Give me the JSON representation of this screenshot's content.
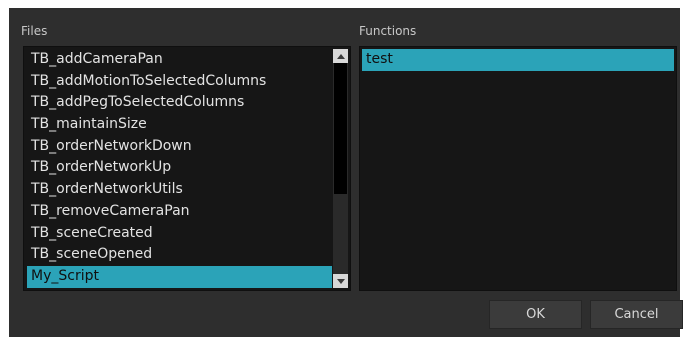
{
  "files": {
    "label": "Files",
    "items": [
      "TB_addCameraPan",
      "TB_addMotionToSelectedColumns",
      "TB_addPegToSelectedColumns",
      "TB_maintainSize",
      "TB_orderNetworkDown",
      "TB_orderNetworkUp",
      "TB_orderNetworkUtils",
      "TB_removeCameraPan",
      "TB_sceneCreated",
      "TB_sceneOpened",
      "My_Script"
    ],
    "selected": "My_Script"
  },
  "functions": {
    "label": "Functions",
    "items": [
      "test"
    ],
    "selected": "test"
  },
  "buttons": {
    "ok": "OK",
    "cancel": "Cancel"
  },
  "colors": {
    "selection": "#2ba3b8",
    "dialog_bg": "#2e2e2e",
    "list_bg": "#161616"
  },
  "icons": {
    "scroll_up": "triangle-up",
    "scroll_down": "triangle-down"
  }
}
